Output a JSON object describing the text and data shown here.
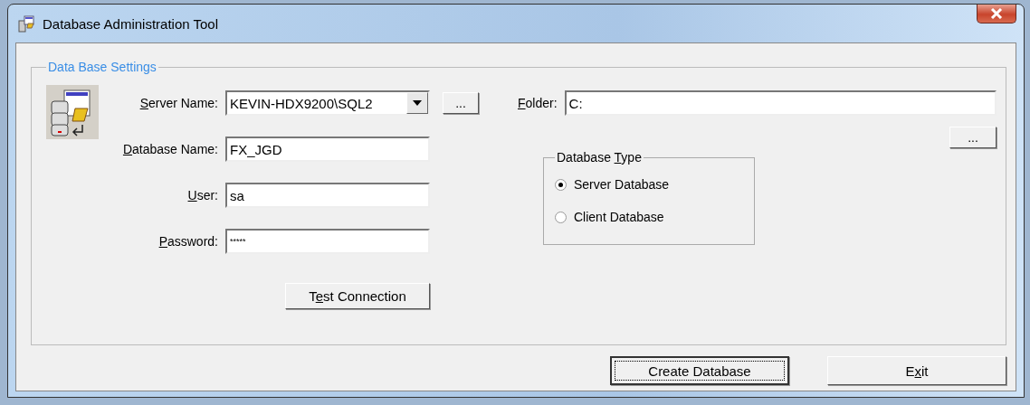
{
  "window": {
    "title": "Database Administration Tool"
  },
  "settings": {
    "title": "Data Base Settings",
    "fields": [
      {
        "kind": "combo",
        "label": {
          "key": "S",
          "post": "erver Name:"
        },
        "value": "KEVIN-HDX9200\\SQL2",
        "browse": "..."
      },
      {
        "kind": "text",
        "label": {
          "key": "D",
          "post": "atabase Name:"
        },
        "value": "FX_JGD"
      },
      {
        "kind": "text",
        "label": {
          "key": "U",
          "post": "ser:"
        },
        "value": "sa"
      },
      {
        "kind": "password",
        "label": {
          "key": "P",
          "post": "assword:"
        },
        "value": "*****"
      }
    ],
    "test_button": {
      "pre": "T",
      "key": "e",
      "post": "st Connection"
    },
    "folder": {
      "label": {
        "key": "F",
        "post": "older:"
      },
      "value": "C:",
      "browse": "..."
    },
    "database_type": {
      "title": {
        "pre": "Database ",
        "key": "T",
        "post": "ype"
      },
      "options": [
        {
          "label": "Server Database",
          "selected": true
        },
        {
          "label": "Client Database",
          "selected": false
        }
      ]
    }
  },
  "buttons": [
    {
      "label": {
        "pre": "Create Database"
      },
      "focused": true
    },
    {
      "label": {
        "pre": "E",
        "key": "x",
        "post": "it"
      },
      "focused": false
    }
  ]
}
